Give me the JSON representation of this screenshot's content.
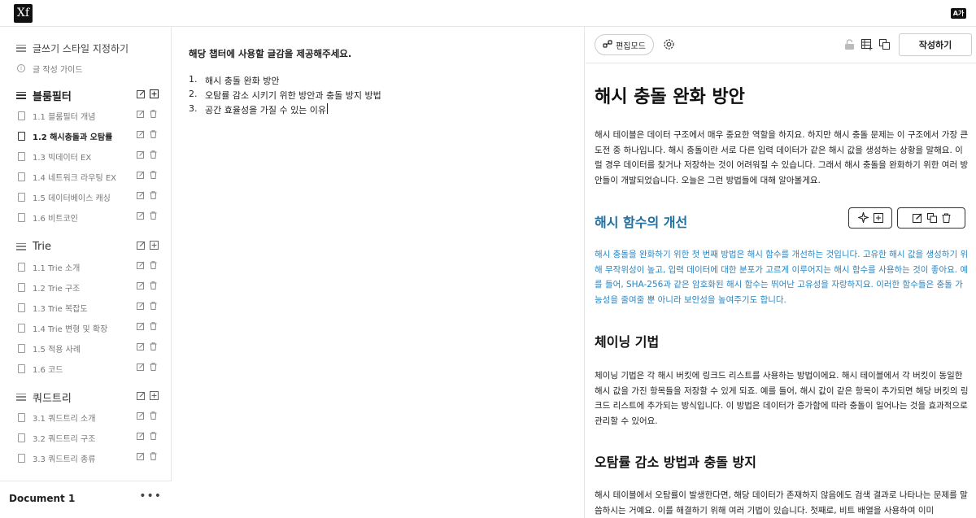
{
  "app": {
    "logo": "Xf",
    "lang_badge": "A가"
  },
  "sidebar": {
    "top_items": [
      {
        "label": "글쓰기 스타일 지정하기"
      },
      {
        "label": "글 작성 가이드"
      }
    ],
    "groups": [
      {
        "label": "블룸필터",
        "items": [
          "1.1 블룸필터 개념",
          "1.2 해시충돌과 오탐률",
          "1.3 빅데이터 EX",
          "1.4 네트워크 라우팅 EX",
          "1.5 데이터베이스 캐싱",
          "1.6 비트코인"
        ]
      },
      {
        "label": "Trie",
        "items": [
          "1.1 Trie 소개",
          "1.2 Trie 구조",
          "1.3 Trie 복잡도",
          "1.4 Trie 변형 및 확장",
          "1.5 적용 사례",
          "1.6 코드"
        ]
      },
      {
        "label": "쿼드트리",
        "items": [
          "3.1 쿼드트리 소개",
          "3.2 쿼드트리 구조",
          "3.3 쿼드트리 종류"
        ]
      }
    ],
    "footer": {
      "document_label": "Document 1",
      "more": "•••"
    }
  },
  "editor": {
    "title": "해당 챕터에 사용할 글감을 제공해주세요.",
    "list": [
      {
        "num": "1.",
        "text": "해시 충돌 완화 방안"
      },
      {
        "num": "2.",
        "text": "오탐률 감소 시키기 위한 방안과 충돌 방지 방법"
      },
      {
        "num": "3.",
        "text": "공간 효율성을 가질 수 있는 이유"
      }
    ]
  },
  "preview": {
    "toolbar": {
      "edit_mode_label": "편집모드",
      "write_button": "작성하기"
    },
    "h1": "해시 충돌 완화 방안",
    "p1": "해시 테이블은 데이터 구조에서 매우 중요한 역할을 하지요. 하지만 해시 충돌 문제는 이 구조에서 가장 큰 도전 중 하나입니다. 해시 충돌이란 서로 다른 입력 데이터가 같은 해시 값을 생성하는 상황을 말해요. 이럴 경우 데이터를 찾거나 저장하는 것이 어려워질 수 있습니다. 그래서 해시 충돌을 완화하기 위한 여러 방안들이 개발되었습니다. 오늘은 그런 방법들에 대해 알아볼게요.",
    "h2_a": "해시 함수의 개선",
    "p2": "해시 충돌을 완화하기 위한 첫 번째 방법은 해시 함수를 개선하는 것입니다. 고유한 해시 값을 생성하기 위해 무작위성이 높고, 입력 데이터에 대한 분포가 고르게 이루어지는 해시 함수를 사용하는 것이 좋아요. 예를 들어, SHA-256과 같은 암호화된 해시 함수는 뛰어난 고유성을 자랑하지요. 이러한 함수들은 충돌 가능성을 줄여줄 뿐 아니라 보안성을 높여주기도 합니다.",
    "h2_b": "체이닝 기법",
    "p3": "체이닝 기법은 각 해시 버킷에 링크드 리스트를 사용하는 방법이에요. 해시 테이블에서 각 버킷이 동일한 해시 값을 가진 항목들을 저장할 수 있게 되죠. 예를 들어, 해시 값이 같은 항목이 추가되면 해당 버킷의 링크드 리스트에 추가되는 방식입니다. 이 방법은 데이터가 증가함에 따라 충돌이 일어나는 것을 효과적으로 관리할 수 있어요.",
    "h2_c": "오탐률 감소 방법과 충돌 방지",
    "p4": "해시 테이블에서 오탐률이 발생한다면, 해당 데이터가 존재하지 않음에도 검색 결과로 나타나는 문제를 말씀하시는 거예요. 이를 해결하기 위해 여러 기법이 있습니다. 첫째로, 비트 배열을 사용하여 이미"
  }
}
